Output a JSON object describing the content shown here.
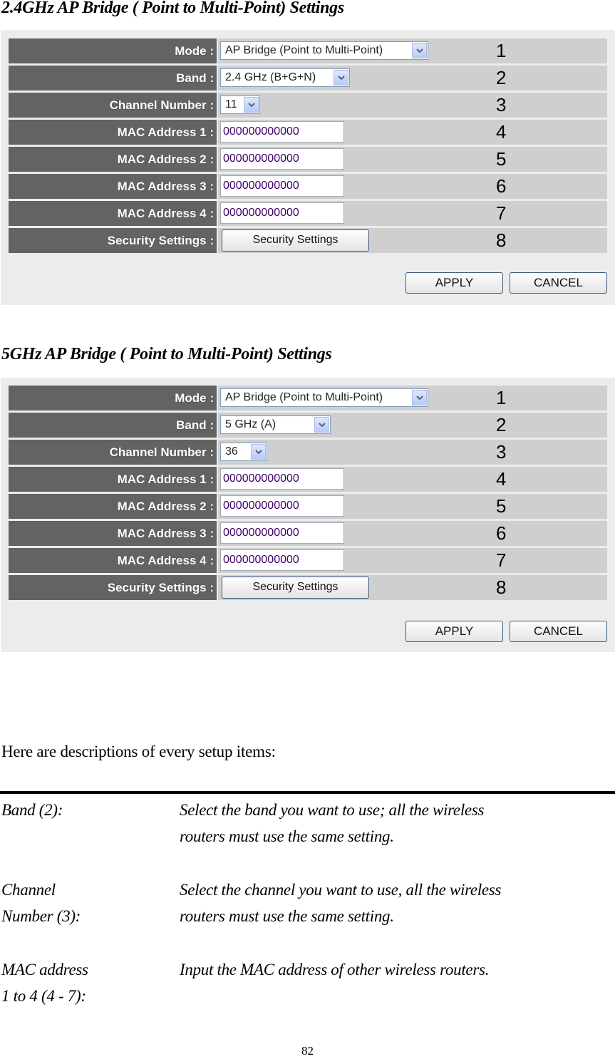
{
  "sections": [
    {
      "title": "2.4GHz AP Bridge ( Point to Multi-Point) Settings",
      "rows": [
        {
          "label": "Mode :",
          "type": "select",
          "value": "AP Bridge (Point to Multi-Point)",
          "callout": "1"
        },
        {
          "label": "Band :",
          "type": "select",
          "value": "2.4 GHz (B+G+N)",
          "callout": "2"
        },
        {
          "label": "Channel Number :",
          "type": "select",
          "value": "11",
          "callout": "3"
        },
        {
          "label": "MAC Address 1 :",
          "type": "text",
          "value": "000000000000",
          "callout": "4"
        },
        {
          "label": "MAC Address 2 :",
          "type": "text",
          "value": "000000000000",
          "callout": "5"
        },
        {
          "label": "MAC Address 3 :",
          "type": "text",
          "value": "000000000000",
          "callout": "6"
        },
        {
          "label": "MAC Address 4 :",
          "type": "text",
          "value": "000000000000",
          "callout": "7"
        },
        {
          "label": "Security Settings :",
          "type": "button",
          "value": "Security Settings",
          "callout": "8"
        }
      ],
      "apply_label": "APPLY",
      "cancel_label": "CANCEL"
    },
    {
      "title": "5GHz AP Bridge ( Point to Multi-Point) Settings",
      "rows": [
        {
          "label": "Mode :",
          "type": "select",
          "value": "AP Bridge (Point to Multi-Point)",
          "callout": "1"
        },
        {
          "label": "Band :",
          "type": "select",
          "value": "5 GHz (A)",
          "callout": "2"
        },
        {
          "label": "Channel Number :",
          "type": "select",
          "value": "36",
          "callout": "3"
        },
        {
          "label": "MAC Address 1 :",
          "type": "text",
          "value": "000000000000",
          "callout": "4"
        },
        {
          "label": "MAC Address 2 :",
          "type": "text",
          "value": "000000000000",
          "callout": "5"
        },
        {
          "label": "MAC Address 3 :",
          "type": "text",
          "value": "000000000000",
          "callout": "6"
        },
        {
          "label": "MAC Address 4 :",
          "type": "text",
          "value": "000000000000",
          "callout": "7"
        },
        {
          "label": "Security Settings :",
          "type": "button",
          "value": "Security Settings",
          "callout": "8"
        }
      ],
      "apply_label": "APPLY",
      "cancel_label": "CANCEL"
    }
  ],
  "intro": "Here are descriptions of every setup items:",
  "descriptions": [
    {
      "term_lines": [
        "Band (2):"
      ],
      "def_lines": [
        "Select the band you want to use; all the wireless",
        "routers must use the same setting."
      ]
    },
    {
      "term_lines": [
        "Channel",
        "Number (3):"
      ],
      "def_lines": [
        "Select the channel you want to use, all the wireless",
        "routers must use the same setting."
      ]
    },
    {
      "term_lines": [
        "MAC address",
        "1 to 4 (4 - 7):"
      ],
      "def_lines": [
        "Input the MAC address of other wireless routers."
      ]
    }
  ],
  "page_number": "82",
  "icons": {
    "dropdown_arrow": "chevron-down-icon"
  }
}
